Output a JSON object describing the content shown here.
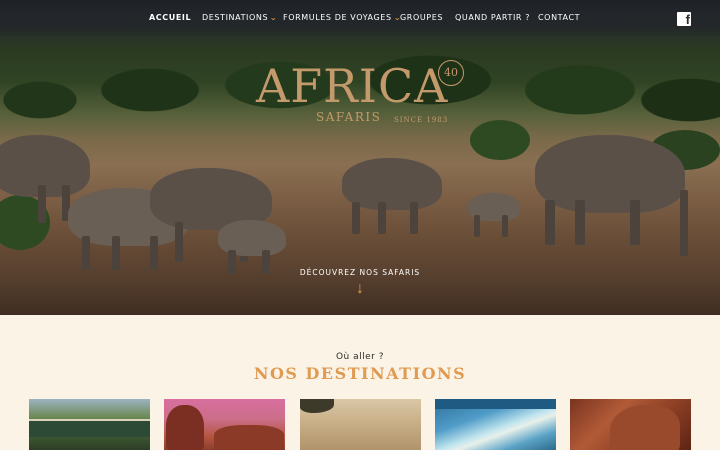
{
  "nav": {
    "items": [
      {
        "label": "ACCUEIL",
        "dropdown": false,
        "active": true
      },
      {
        "label": "DESTINATIONS",
        "dropdown": true,
        "active": false
      },
      {
        "label": "FORMULES DE VOYAGES",
        "dropdown": true,
        "active": false
      },
      {
        "label": "GROUPES",
        "dropdown": false,
        "active": false
      },
      {
        "label": "QUAND PARTIR ?",
        "dropdown": false,
        "active": false
      },
      {
        "label": "CONTACT",
        "dropdown": false,
        "active": false
      }
    ],
    "caret": "⌄",
    "social_icon": "facebook-icon",
    "social_glyph": "f"
  },
  "logo": {
    "title": "AFRICA",
    "subtitle": "SAFARIS",
    "since": "SINCE 1983",
    "badge": "40"
  },
  "hero": {
    "cta_label": "DÉCOUVREZ NOS SAFARIS",
    "cta_icon": "arrow-down-icon",
    "cta_glyph": "↓"
  },
  "section": {
    "kicker": "Où aller ?",
    "title": "NOS DESTINATIONS"
  },
  "cards": [
    {
      "icon": "train-photo"
    },
    {
      "icon": "elephants-pink-sky-photo"
    },
    {
      "icon": "savanna-tree-photo"
    },
    {
      "icon": "lagoon-aerial-photo"
    },
    {
      "icon": "himba-portrait-photo"
    }
  ],
  "colors": {
    "accent": "#e09a52",
    "logo_gold": "#c49a6c",
    "background": "#fbf3e6"
  }
}
